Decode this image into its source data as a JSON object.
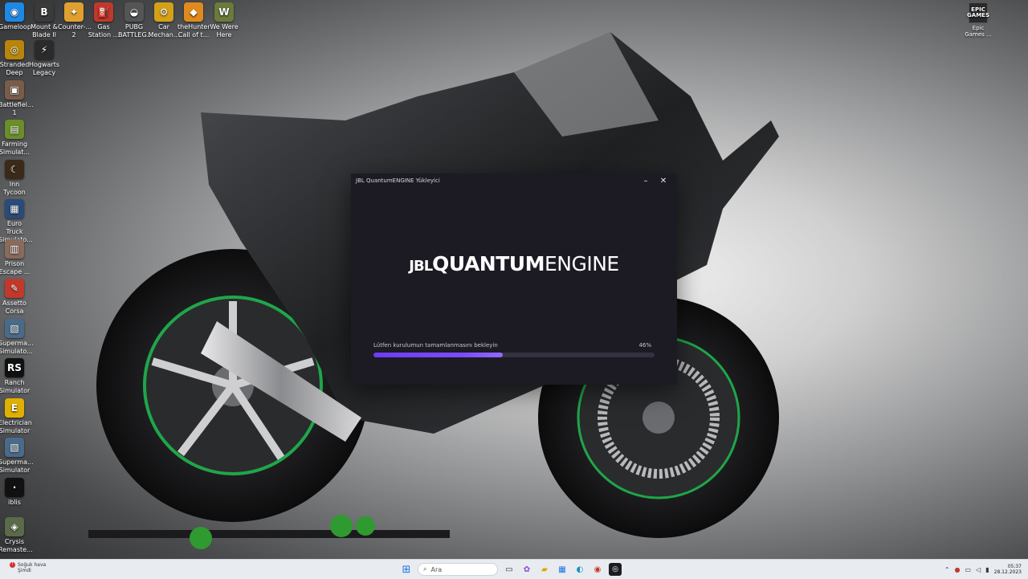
{
  "desktop": {
    "icons": [
      {
        "label": "Gameloop",
        "icon": "gameloop-icon",
        "color": "#1e88e5",
        "glyph": "◉"
      },
      {
        "label": "Mount &\nBlade II ...",
        "icon": "mount-blade-icon",
        "color": "#3a3a3a",
        "glyph": "B"
      },
      {
        "label": "Counter-...\n2",
        "icon": "counter-strike-icon",
        "color": "#e0a030",
        "glyph": "✦"
      },
      {
        "label": "Gas\nStation ...",
        "icon": "gas-station-icon",
        "color": "#c0392b",
        "glyph": "⛽"
      },
      {
        "label": "PUBG\nBATTLEG...",
        "icon": "pubg-icon",
        "color": "#555",
        "glyph": "◒"
      },
      {
        "label": "Car\nMechan...",
        "icon": "car-mechanic-icon",
        "color": "#d4a017",
        "glyph": "⚙"
      },
      {
        "label": "theHunter\nCall of t...",
        "icon": "thehunter-icon",
        "color": "#e08a1e",
        "glyph": "◆"
      },
      {
        "label": "We Were\nHere",
        "icon": "we-were-here-icon",
        "color": "#6b7b3a",
        "glyph": "W"
      },
      {
        "label": "Stranded\nDeep",
        "icon": "stranded-deep-icon",
        "color": "#b8860b",
        "glyph": "◎"
      },
      {
        "label": "Hogwarts\nLegacy",
        "icon": "hogwarts-icon",
        "color": "#2b2b2b",
        "glyph": "⚡"
      },
      {
        "label": "Battlefiel...\n1",
        "icon": "battlefield-icon",
        "color": "#7a5c4a",
        "glyph": "▣"
      },
      {
        "label": "Farming\nSimulat...",
        "icon": "farming-simulator-icon",
        "color": "#6a8f2a",
        "glyph": "▤"
      },
      {
        "label": "Inn Tycoon",
        "icon": "inn-tycoon-icon",
        "color": "#3a2a1a",
        "glyph": "☾"
      },
      {
        "label": "Euro Truck\nSimulato...",
        "icon": "euro-truck-icon",
        "color": "#2a4a7a",
        "glyph": "▦"
      },
      {
        "label": "Prison\nEscape ...",
        "icon": "prison-escape-icon",
        "color": "#8a6a5a",
        "glyph": "▥"
      },
      {
        "label": "Assetto\nCorsa",
        "icon": "assetto-corsa-icon",
        "color": "#c0392b",
        "glyph": "✎"
      },
      {
        "label": "Superma...\nSimulato...",
        "icon": "supermarket-sim-icon",
        "color": "#4a6a8a",
        "glyph": "▧"
      },
      {
        "label": "Ranch\nSimulator",
        "icon": "ranch-simulator-icon",
        "color": "#111",
        "glyph": "RS"
      },
      {
        "label": "Electrician\nSimulator",
        "icon": "electrician-icon",
        "color": "#e0b000",
        "glyph": "E"
      },
      {
        "label": "Superma...\nSimulator",
        "icon": "supermarket-sim2-icon",
        "color": "#4a6a8a",
        "glyph": "▧"
      },
      {
        "label": "iblis",
        "icon": "iblis-icon",
        "color": "#111",
        "glyph": "·"
      },
      {
        "label": "Crysis\nRemaste...",
        "icon": "crysis-icon",
        "color": "#5a6a4a",
        "glyph": "◈"
      }
    ],
    "epic": {
      "label": "Epic\nGames ...",
      "logo_text": "EPIC\nGAMES"
    }
  },
  "installer": {
    "title": "JBL QuantumENGINE Yükleyici",
    "logo_jbl": "JBL",
    "logo_quantum": "QUANTUM",
    "logo_engine": "ENGINE",
    "status_text": "Lütfen kurulumun tamamlanmasını bekleyin",
    "progress_label": "46%",
    "progress_value": 0.46,
    "minimize_glyph": "–",
    "close_glyph": "✕"
  },
  "taskbar": {
    "weather_line1": "Soğuk hava",
    "weather_line2": "Şimdi",
    "search_placeholder": "Ara",
    "time": "05:37",
    "date": "28.12.2023"
  }
}
